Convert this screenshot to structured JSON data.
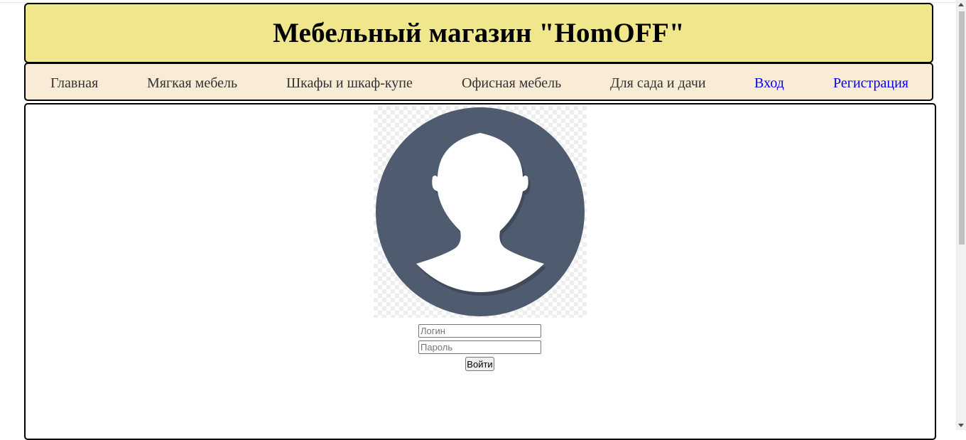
{
  "header": {
    "title": "Мебельный магазин \"HomOFF\""
  },
  "nav": {
    "items": [
      {
        "label": "Главная"
      },
      {
        "label": "Мягкая мебель"
      },
      {
        "label": "Шкафы и шкаф-купе"
      },
      {
        "label": "Офисная мебель"
      },
      {
        "label": "Для сада и дачи"
      },
      {
        "label": "Вход"
      },
      {
        "label": "Регистрация"
      }
    ]
  },
  "login": {
    "login_placeholder": "Логин",
    "password_placeholder": "Пароль",
    "submit_label": "Войти"
  },
  "colors": {
    "header_bg": "#f0e68c",
    "nav_bg": "#faebd7",
    "link_blue": "#0000ee",
    "avatar_circle": "#4f5b6f"
  },
  "icons": {
    "avatar": "user-avatar-icon"
  }
}
